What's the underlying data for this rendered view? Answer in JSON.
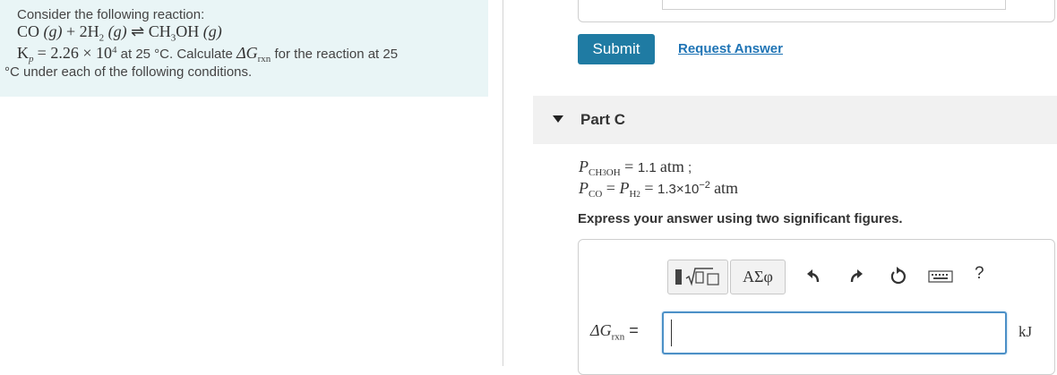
{
  "problem": {
    "intro": "Consider the following reaction:",
    "equation": {
      "reactant1": "CO",
      "phase1": "(g)",
      "plus": "+",
      "reactant2_coef": "2H",
      "reactant2_sub": "2",
      "phase2": "(g)",
      "arrow": "⇌",
      "product": "CH",
      "product_sub": "3",
      "product_rest": "OH",
      "phase3": "(g)"
    },
    "kp_symbol": "K",
    "kp_sub": "p",
    "kp_value": "= 2.26 × 10",
    "kp_exp": "4",
    "kp_text": " at 25 °C. Calculate ",
    "dg_symbol": "ΔG",
    "dg_sub": "rxn",
    "kp_text2": " for the reaction at 25",
    "line3": "°C under each of the following conditions."
  },
  "previous": {
    "submit_label": "Submit",
    "request_answer_label": "Request Answer"
  },
  "part": {
    "title": "Part C",
    "cond1": {
      "p": "P",
      "sub_a": "CH",
      "sub_b": "3",
      "sub_c": "OH",
      "eq": " = ",
      "value": "1.1",
      "unit": "atm",
      "sep": " ;"
    },
    "cond2": {
      "p1": "P",
      "sub1": "CO",
      "eq1": " = ",
      "p2": "P",
      "sub2": "H",
      "sub2b": "2",
      "eq2": " = ",
      "value": "1.3×10",
      "exp": "−2",
      "unit": "atm"
    },
    "instructions": "Express your answer using two significant figures.",
    "toolbar": {
      "greek_label": "ΑΣφ",
      "help_label": "?"
    },
    "answer_label_delta": "ΔG",
    "answer_label_sub": "rxn",
    "answer_label_eq": " =",
    "answer_value": "",
    "unit": "kJ"
  },
  "colors": {
    "panel_bg": "#e9f5f6",
    "submit_bg": "#1f7ba3",
    "link": "#1f74b5",
    "input_focus": "#4c90c7"
  }
}
